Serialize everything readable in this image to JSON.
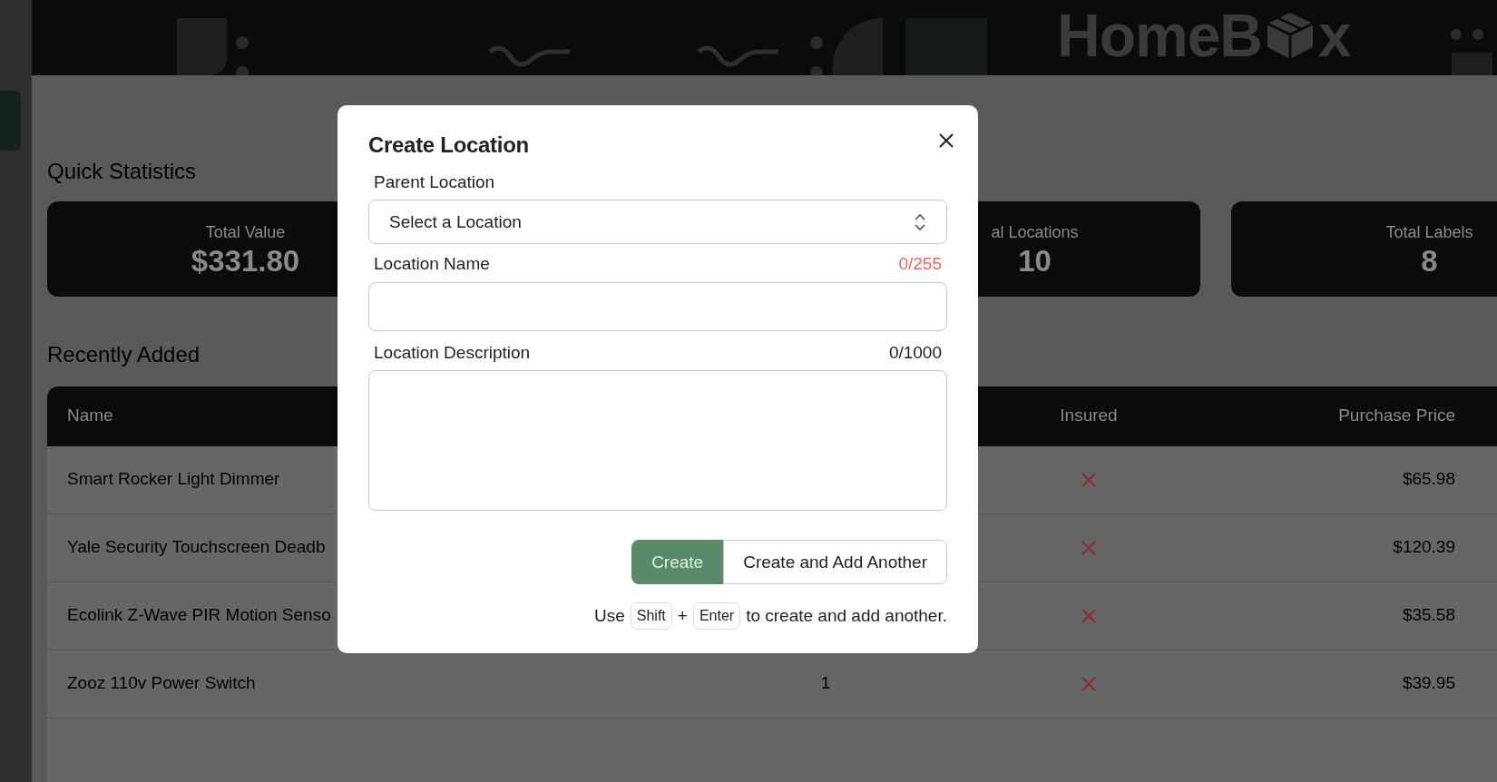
{
  "banner": {
    "logo": {
      "before": "HomeB",
      "after": "x"
    }
  },
  "quick_statistics": {
    "title": "Quick Statistics",
    "cards": [
      {
        "label": "Total Value",
        "value": "$331.80"
      },
      {
        "label": "al Locations",
        "value": "10"
      },
      {
        "label": "Total Labels",
        "value": "8"
      }
    ]
  },
  "recently_added": {
    "title": "Recently Added",
    "columns": [
      {
        "label": "Name",
        "kind": "text"
      },
      {
        "label": "Insured",
        "kind": "flag"
      },
      {
        "label": "Purchase Price",
        "kind": "money"
      }
    ],
    "rows": [
      {
        "name": "Smart Rocker Light Dimmer",
        "insured": false,
        "purchase_price": "$65.98"
      },
      {
        "name": "Yale Security Touchscreen Deadb",
        "insured": false,
        "purchase_price": "$120.39"
      },
      {
        "name": "Ecolink Z-Wave PIR Motion Senso",
        "insured": false,
        "purchase_price": "$35.58"
      },
      {
        "name": "Zooz 110v Power Switch",
        "column_2": "1",
        "insured": false,
        "purchase_price": "$39.95"
      }
    ]
  },
  "dialog": {
    "title": "Create Location",
    "parent_location": {
      "label": "Parent Location",
      "value": "Select a Location"
    },
    "location_name": {
      "label": "Location Name",
      "counter": "0/255",
      "counter_error": true
    },
    "location_description": {
      "label": "Location Description",
      "counter": "0/1000",
      "counter_error": false
    },
    "buttons": [
      {
        "label": "Create",
        "kind": "primary"
      },
      {
        "label": "Create and Add Another",
        "kind": "outline"
      }
    ],
    "hint": {
      "before": "Use",
      "keys": [
        "Shift",
        "Enter"
      ],
      "joiner": "+",
      "after": "to create and add another."
    }
  }
}
